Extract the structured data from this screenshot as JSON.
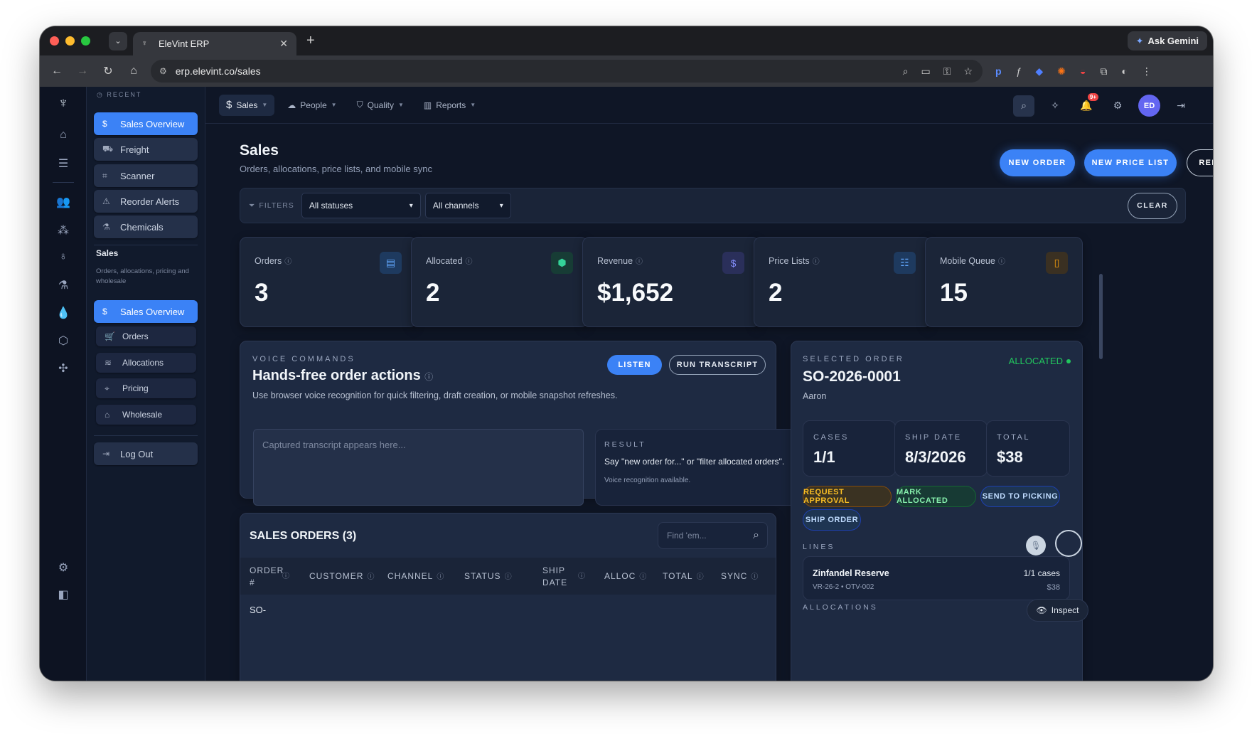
{
  "browser": {
    "tab_title": "EleVint ERP",
    "url": "erp.elevint.co/sales",
    "gemini_label": "Ask Gemini"
  },
  "sidebar": {
    "recent_label": "RECENT",
    "recent_items": [
      {
        "label": "Sales Overview",
        "icon": "dollar-icon"
      },
      {
        "label": "Freight",
        "icon": "truck-icon"
      },
      {
        "label": "Scanner",
        "icon": "scan-icon"
      },
      {
        "label": "Reorder Alerts",
        "icon": "alert-icon"
      },
      {
        "label": "Chemicals",
        "icon": "flask-icon"
      }
    ],
    "section_title": "Sales",
    "section_desc": "Orders, allocations, pricing and wholesale",
    "section_items": [
      {
        "label": "Sales Overview",
        "icon": "dollar-icon"
      },
      {
        "label": "Orders",
        "icon": "cart-icon"
      },
      {
        "label": "Allocations",
        "icon": "layers-icon"
      },
      {
        "label": "Pricing",
        "icon": "tag-icon"
      },
      {
        "label": "Wholesale",
        "icon": "store-icon"
      }
    ],
    "logout_label": "Log Out"
  },
  "topnav": {
    "items": [
      "Sales",
      "People",
      "Quality",
      "Reports"
    ],
    "notification_badge": "9+",
    "avatar_initials": "ED"
  },
  "page": {
    "title": "Sales",
    "subtitle": "Orders, allocations, price lists, and mobile sync",
    "buttons": {
      "new_order": "NEW ORDER",
      "new_price_list": "NEW PRICE LIST",
      "refresh": "REFRESH"
    }
  },
  "filters": {
    "label": "FILTERS",
    "status": "All statuses",
    "channel": "All channels",
    "clear": "CLEAR"
  },
  "stats": [
    {
      "label": "Orders",
      "value": "3",
      "icon": "clipboard-icon",
      "color": "#60a5fa"
    },
    {
      "label": "Allocated",
      "value": "2",
      "icon": "box-icon",
      "color": "#34d399"
    },
    {
      "label": "Revenue",
      "value": "$1,652",
      "icon": "dollar-icon",
      "color": "#818cf8"
    },
    {
      "label": "Price Lists",
      "value": "2",
      "icon": "checklist-icon",
      "color": "#60a5fa"
    },
    {
      "label": "Mobile Queue",
      "value": "15",
      "icon": "phone-icon",
      "color": "#f59e0b"
    }
  ],
  "voice": {
    "eyebrow": "VOICE COMMANDS",
    "title": "Hands-free order actions",
    "description": "Use browser voice recognition for quick filtering, draft creation, or mobile snapshot refreshes.",
    "listen": "LISTEN",
    "run_transcript": "RUN TRANSCRIPT",
    "transcript_placeholder": "Captured transcript appears here...",
    "result_label": "RESULT",
    "result_text": "Say \"new order for...\" or \"filter allocated orders\".",
    "result_note": "Voice recognition available."
  },
  "orders_table": {
    "title": "SALES ORDERS (3)",
    "search_placeholder": "Find 'em...",
    "columns": [
      "ORDER #",
      "CUSTOMER",
      "CHANNEL",
      "STATUS",
      "SHIP DATE",
      "ALLOC",
      "TOTAL",
      "SYNC"
    ],
    "first_row_partial": "SO-"
  },
  "selected_order": {
    "eyebrow": "SELECTED ORDER",
    "status": "ALLOCATED",
    "order_id": "SO-2026-0001",
    "customer": "Aaron",
    "cases_label": "CASES",
    "cases": "1/1",
    "ship_date_label": "SHIP DATE",
    "ship_date": "8/3/2026",
    "total_label": "TOTAL",
    "total": "$38",
    "actions": [
      "REQUEST APPROVAL",
      "MARK ALLOCATED",
      "SEND TO PICKING",
      "SHIP ORDER"
    ],
    "lines_label": "LINES",
    "line": {
      "name": "Zinfandel Reserve",
      "sku": "VR-26-2 • OTV-002",
      "qty": "1/1 cases",
      "price": "$38"
    },
    "allocations_label": "ALLOCATIONS",
    "inspect": "Inspect"
  }
}
